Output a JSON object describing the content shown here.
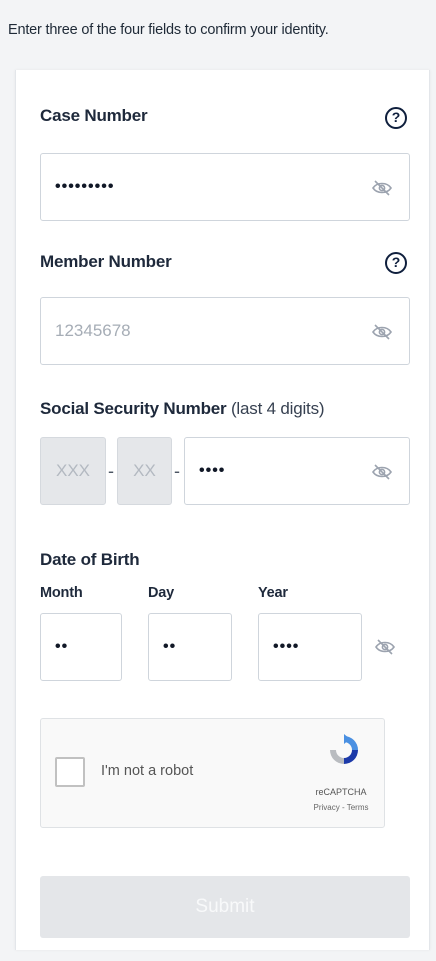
{
  "intro": "Enter three of the four fields to confirm your identity.",
  "case": {
    "label": "Case Number",
    "value": "•••••••••"
  },
  "member": {
    "label": "Member Number",
    "placeholder": "12345678"
  },
  "ssn": {
    "label": "Social Security Number",
    "label_suffix": " (last 4 digits)",
    "part1": "XXX",
    "part2": "XX",
    "sep": "-",
    "value": "••••"
  },
  "dob": {
    "label": "Date of Birth",
    "month_label": "Month",
    "day_label": "Day",
    "year_label": "Year",
    "month_value": "••",
    "day_value": "••",
    "year_value": "••••"
  },
  "help_glyph": "?",
  "captcha": {
    "text": "I'm not a robot",
    "brand": "reCAPTCHA",
    "links": "Privacy - Terms"
  },
  "submit_label": "Submit",
  "icons": {
    "eye": "eye-slash-icon",
    "help": "question-circle-icon",
    "recaptcha": "recaptcha-logo-icon"
  }
}
